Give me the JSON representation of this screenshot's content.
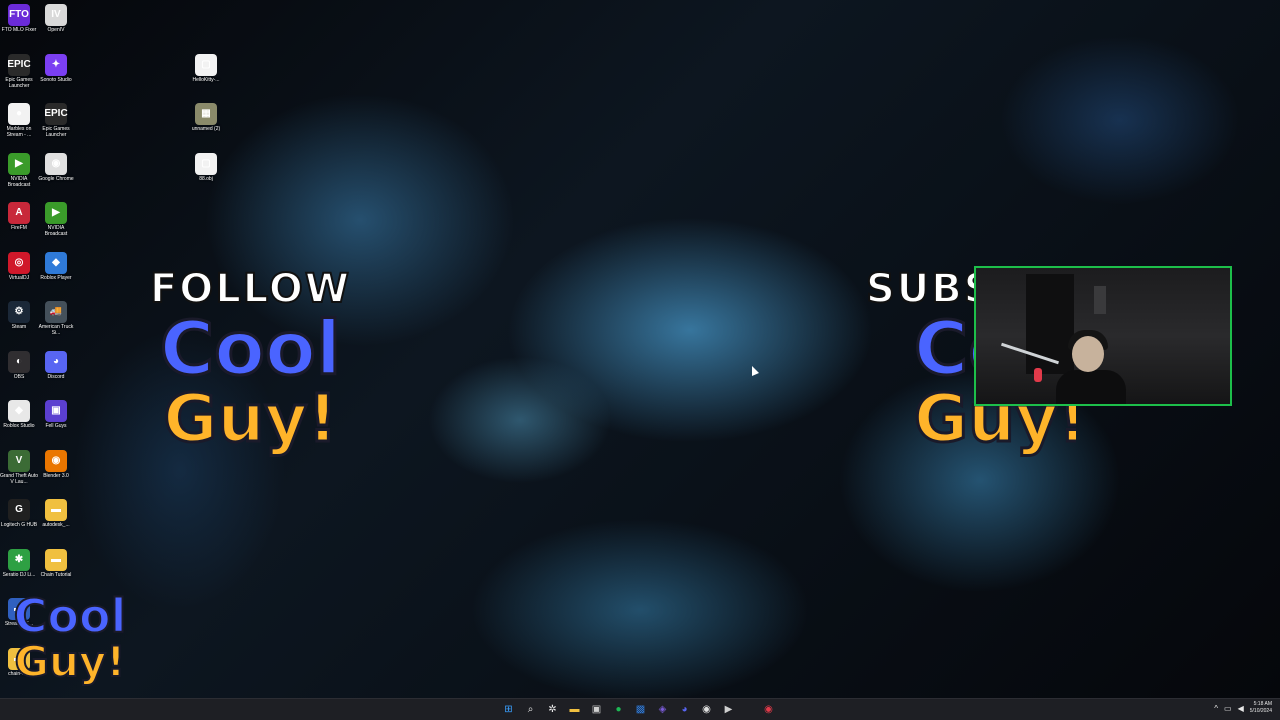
{
  "desktop": {
    "icons": [
      {
        "label": "FTO MLO Fixer",
        "glyph": "FTO",
        "color": "#6b2bd8",
        "col": 0,
        "row": 0
      },
      {
        "label": "OpenIV",
        "glyph": "IV",
        "color": "#d9d9d9",
        "col": 1,
        "row": 0
      },
      {
        "label": "Epic Games Launcher",
        "glyph": "EPIC",
        "color": "#2a2a2a",
        "col": 0,
        "row": 1
      },
      {
        "label": "Sonoto Studio",
        "glyph": "✦",
        "color": "#7b3ff2",
        "col": 1,
        "row": 1
      },
      {
        "label": "Marbles on Stream - ...",
        "glyph": "●",
        "color": "#f2f2f2",
        "col": 0,
        "row": 2
      },
      {
        "label": "Epic Games Launcher",
        "glyph": "EPIC",
        "color": "#2a2a2a",
        "col": 1,
        "row": 2
      },
      {
        "label": "NVIDIA Broadcast",
        "glyph": "▶",
        "color": "#3a9b2a",
        "col": 0,
        "row": 3
      },
      {
        "label": "Google Chrome",
        "glyph": "◉",
        "color": "#e0e0e0",
        "col": 1,
        "row": 3
      },
      {
        "label": "FireFM",
        "glyph": "A",
        "color": "#c8283a",
        "col": 0,
        "row": 4
      },
      {
        "label": "NVIDIA Broadcast",
        "glyph": "▶",
        "color": "#3a9b2a",
        "col": 1,
        "row": 4
      },
      {
        "label": "VirtualDJ",
        "glyph": "◎",
        "color": "#d0182a",
        "col": 0,
        "row": 5
      },
      {
        "label": "Roblox Player",
        "glyph": "◆",
        "color": "#2f7ad8",
        "col": 1,
        "row": 5
      },
      {
        "label": "Steam",
        "glyph": "⚙",
        "color": "#1b2838",
        "col": 0,
        "row": 6
      },
      {
        "label": "American Truck Si...",
        "glyph": "🚚",
        "color": "#44505a",
        "col": 1,
        "row": 6
      },
      {
        "label": "OBS",
        "glyph": "◐",
        "color": "#302e31",
        "col": 0,
        "row": 7
      },
      {
        "label": "Discord",
        "glyph": "◕",
        "color": "#5865f2",
        "col": 1,
        "row": 7
      },
      {
        "label": "Roblox Studio",
        "glyph": "◆",
        "color": "#e8e8e8",
        "col": 0,
        "row": 8
      },
      {
        "label": "Fell Guys",
        "glyph": "▣",
        "color": "#5b3fd0",
        "col": 1,
        "row": 8
      },
      {
        "label": "Grand Theft Auto V Lau...",
        "glyph": "V",
        "color": "#3b6b35",
        "col": 0,
        "row": 9
      },
      {
        "label": "Blender 3.0",
        "glyph": "◉",
        "color": "#ea7600",
        "col": 1,
        "row": 9
      },
      {
        "label": "Logitech G HUB",
        "glyph": "G",
        "color": "#202020",
        "col": 0,
        "row": 10
      },
      {
        "label": "autodesk_...",
        "glyph": "▬",
        "color": "#f0c040",
        "col": 1,
        "row": 10
      },
      {
        "label": "Seratio DJ Li...",
        "glyph": "✱",
        "color": "#2ea043",
        "col": 0,
        "row": 11
      },
      {
        "label": "Chain Tutorial",
        "glyph": "▬",
        "color": "#f0c040",
        "col": 1,
        "row": 11
      },
      {
        "label": "Stream SE...",
        "glyph": "▬",
        "color": "#3060c0",
        "col": 0,
        "row": 12
      },
      {
        "label": "chain-ct...",
        "glyph": "▬",
        "color": "#f0c040",
        "col": 0,
        "row": 13
      },
      {
        "label": "HelloKitty-...",
        "glyph": "▢",
        "color": "#f2f2f2",
        "col": 4,
        "row": 1
      },
      {
        "label": "unnamed (2)",
        "glyph": "▦",
        "color": "#8a8a6a",
        "col": 4,
        "row": 2
      },
      {
        "label": "88.obj",
        "glyph": "▢",
        "color": "#f2f2f2",
        "col": 4,
        "row": 3
      }
    ]
  },
  "overlays": {
    "follow_word": "FOLLOW",
    "subscribe_word": "SUBS",
    "brand_line1": "Cool",
    "brand_line2": "Guy!"
  },
  "webcam": {
    "border_color": "#1dbf4a"
  },
  "taskbar": {
    "apps": [
      {
        "name": "start-button",
        "glyph": "⊞",
        "color": "#3aa0ff"
      },
      {
        "name": "search-button",
        "glyph": "⌕",
        "color": "#e8e8e8"
      },
      {
        "name": "task-view-button",
        "glyph": "✲",
        "color": "#e8e8e8"
      },
      {
        "name": "file-explorer-button",
        "glyph": "▬",
        "color": "#f0c040"
      },
      {
        "name": "store-button",
        "glyph": "▣",
        "color": "#d0d0d0"
      },
      {
        "name": "spotify-button",
        "glyph": "●",
        "color": "#1db954"
      },
      {
        "name": "app-blue-button",
        "glyph": "▩",
        "color": "#2f7ad8"
      },
      {
        "name": "app-purple-button",
        "glyph": "◈",
        "color": "#7b5cd8"
      },
      {
        "name": "discord-button",
        "glyph": "◕",
        "color": "#5865f2"
      },
      {
        "name": "chrome-button",
        "glyph": "◉",
        "color": "#e0e0e0"
      },
      {
        "name": "media-button",
        "glyph": "▶",
        "color": "#cfcfcf"
      },
      {
        "name": "record-button",
        "glyph": "◉",
        "color": "#e23a4a"
      }
    ],
    "tray_chevron": "^",
    "time": "5:18 AM",
    "date": "5/10/2024"
  }
}
